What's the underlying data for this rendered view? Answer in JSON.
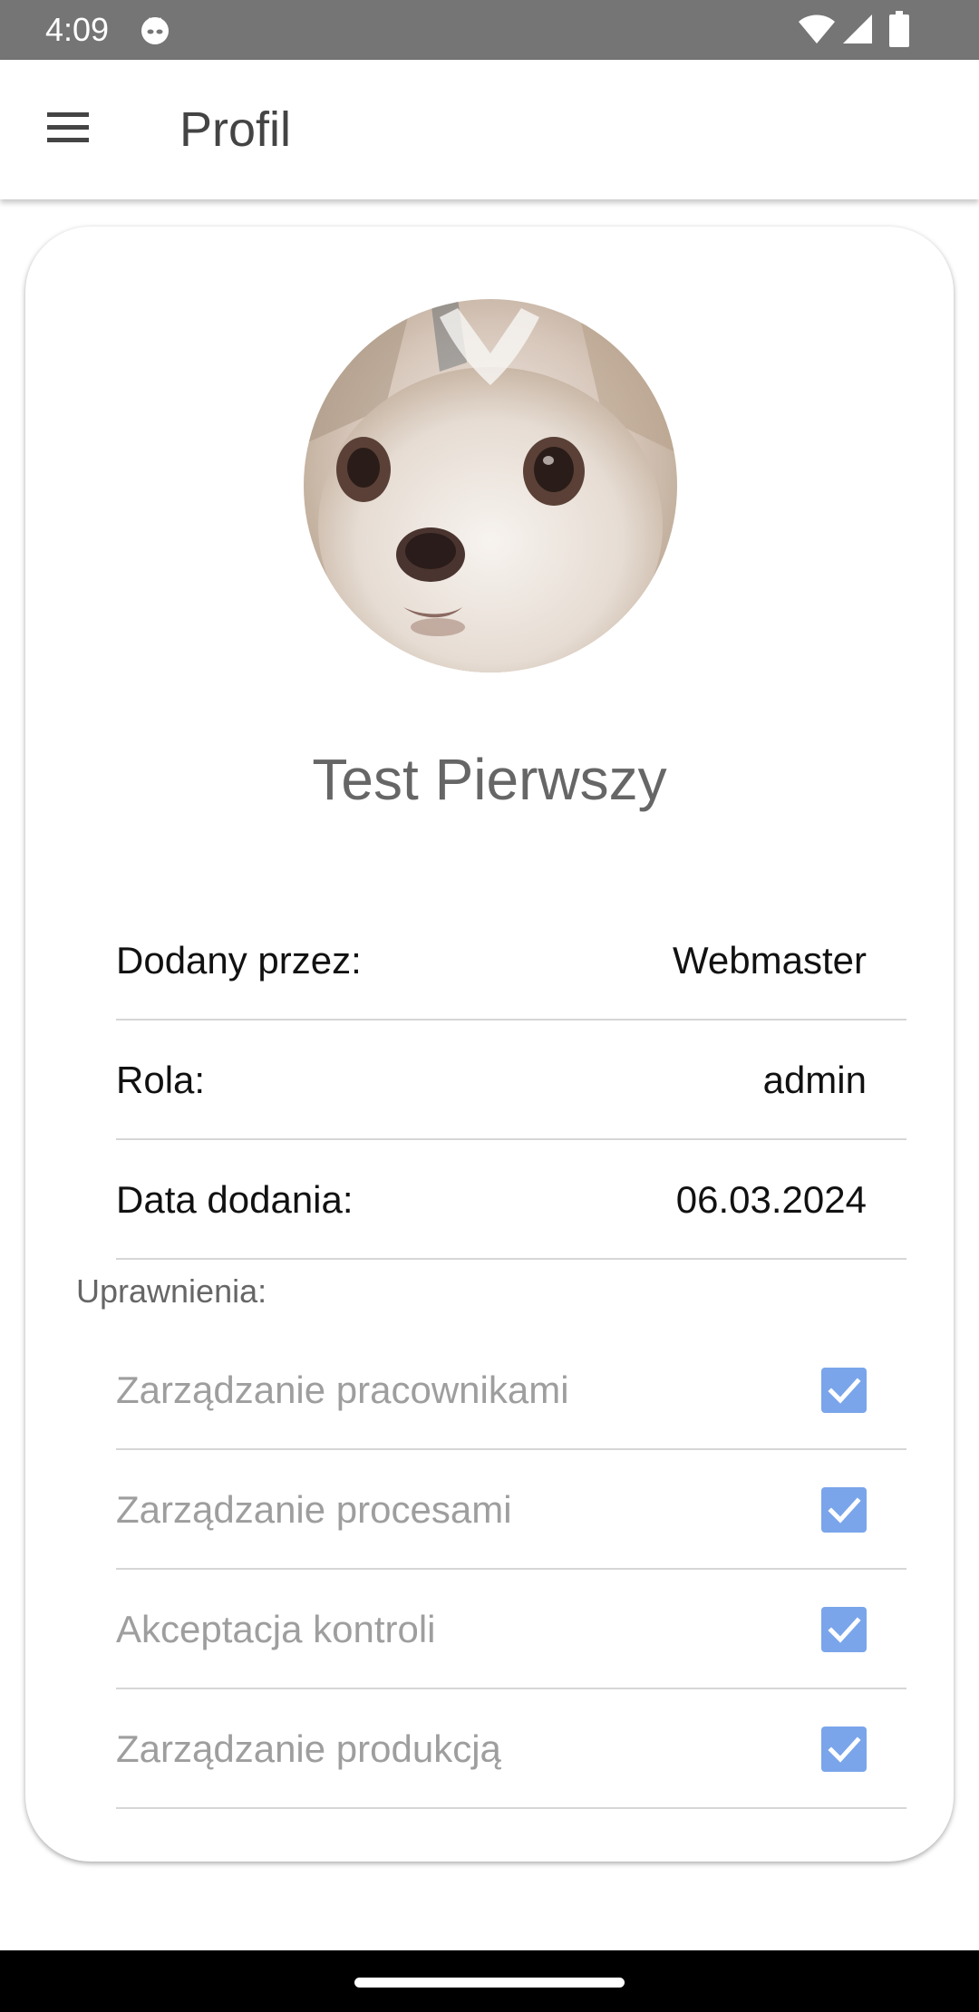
{
  "status_bar": {
    "time": "4:09"
  },
  "app_bar": {
    "title": "Profil",
    "menu_icon": "hamburger-menu-icon"
  },
  "profile": {
    "name": "Test Pierwszy",
    "avatar": "dog-photo-avatar",
    "details": [
      {
        "label": "Dodany przez:",
        "value": "Webmaster"
      },
      {
        "label": "Rola:",
        "value": "admin"
      },
      {
        "label": "Data dodania:",
        "value": "06.03.2024"
      }
    ]
  },
  "permissions": {
    "heading": "Uprawnienia:",
    "items": [
      {
        "label": "Zarządzanie pracownikami",
        "checked": true
      },
      {
        "label": "Zarządzanie procesami",
        "checked": true
      },
      {
        "label": "Akceptacja kontroli",
        "checked": true
      },
      {
        "label": "Zarządzanie produkcją",
        "checked": true
      }
    ],
    "checkbox_color": "#7aa5ea"
  },
  "colors": {
    "status_bar": "#757575",
    "nav_bar": "#000000",
    "accent": "#7aa5ea"
  }
}
